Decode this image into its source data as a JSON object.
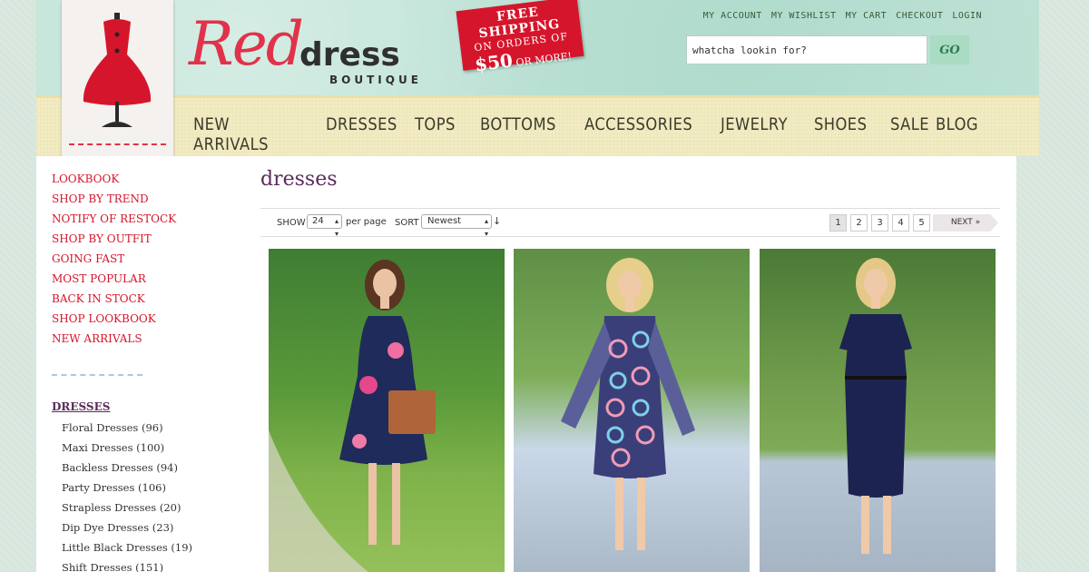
{
  "brand": {
    "logo_script": "Red",
    "logo_word": "dress",
    "logo_sub": "BOUTIQUE",
    "accent": "#d5152b"
  },
  "promo": {
    "line1": "FREE SHIPPING",
    "line2": "ON ORDERS OF",
    "amount": "$50",
    "line3": "OR MORE!"
  },
  "top_links": [
    "MY ACCOUNT",
    "MY WISHLIST",
    "MY CART",
    "CHECKOUT",
    "LOGIN"
  ],
  "search": {
    "value": "whatcha lookin for?",
    "button": "GO"
  },
  "main_nav": [
    "NEW ARRIVALS",
    "DRESSES",
    "TOPS",
    "BOTTOMS",
    "ACCESSORIES",
    "JEWELRY",
    "SHOES",
    "SALE",
    "BLOG"
  ],
  "sidebar": {
    "links": [
      "LOOKBOOK",
      "SHOP BY TREND",
      "NOTIFY OF RESTOCK",
      "SHOP BY OUTFIT",
      "GOING FAST",
      "MOST POPULAR",
      "BACK IN STOCK",
      "SHOP LOOKBOOK",
      "NEW ARRIVALS"
    ],
    "heading": "DRESSES",
    "sub": [
      "Floral Dresses (96)",
      "Maxi Dresses (100)",
      "Backless Dresses (94)",
      "Party Dresses (106)",
      "Strapless Dresses (20)",
      "Dip Dye Dresses (23)",
      "Little Black Dresses (19)",
      "Shift Dresses (151)"
    ]
  },
  "page": {
    "title": "dresses",
    "show_label": "SHOW",
    "show_value": "24",
    "per_page": "per page",
    "sort_label": "SORT",
    "sort_value": "Newest",
    "sort_arrow": "↓",
    "pages": [
      "1",
      "2",
      "3",
      "4",
      "5"
    ],
    "current_page": "1",
    "next": "NEXT »"
  }
}
